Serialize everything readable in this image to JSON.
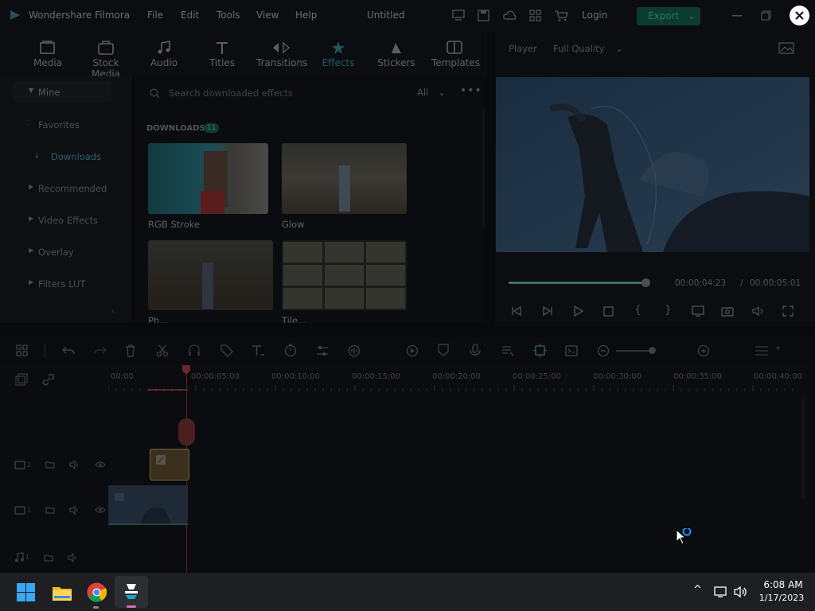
{
  "app": {
    "name": "Wondershare Filmora",
    "menu": [
      "File",
      "Edit",
      "Tools",
      "View",
      "Help"
    ],
    "project_title": "Untitled",
    "login_label": "Login",
    "export_label": "Export"
  },
  "categories": [
    {
      "label": "Media",
      "icon": "media-icon"
    },
    {
      "label": "Stock Media",
      "icon": "stock-media-icon"
    },
    {
      "label": "Audio",
      "icon": "music-note-icon"
    },
    {
      "label": "Titles",
      "icon": "titles-icon"
    },
    {
      "label": "Transitions",
      "icon": "transitions-icon"
    },
    {
      "label": "Effects",
      "icon": "effects-icon"
    },
    {
      "label": "Stickers",
      "icon": "stickers-icon"
    },
    {
      "label": "Templates",
      "icon": "templates-icon"
    }
  ],
  "sidebar": {
    "items": [
      {
        "label": "Mine"
      },
      {
        "label": "Favorites"
      },
      {
        "label": "Downloads"
      },
      {
        "label": "Recommended"
      },
      {
        "label": "Video Effects"
      },
      {
        "label": "Overlay"
      },
      {
        "label": "Filters LUT"
      }
    ]
  },
  "effects_panel": {
    "search_placeholder": "Search downloaded effects",
    "filter_value": "All",
    "section_title": "DOWNLOADS",
    "section_count": "11",
    "items": [
      {
        "label": "RGB Stroke"
      },
      {
        "label": "Glow"
      },
      {
        "label": "Ph..."
      },
      {
        "label": "Tile..."
      }
    ]
  },
  "player": {
    "label": "Player",
    "quality": "Full Quality",
    "current_time": "00:00:04:23",
    "separator": "/",
    "total_time": "00:00:05:01",
    "progress": 0.98
  },
  "timeline": {
    "ruler": [
      "00:00",
      "00:00:05:00",
      "00:00:10:00",
      "00:00:15:00",
      "00:00:20:00",
      "00:00:25:00",
      "00:00:30:00",
      "00:00:35:00",
      "00:00:40:00"
    ],
    "track_numbers": [
      "2",
      "1",
      "1"
    ]
  },
  "taskbar": {
    "time": "6:08 AM",
    "date": "1/17/2023"
  }
}
